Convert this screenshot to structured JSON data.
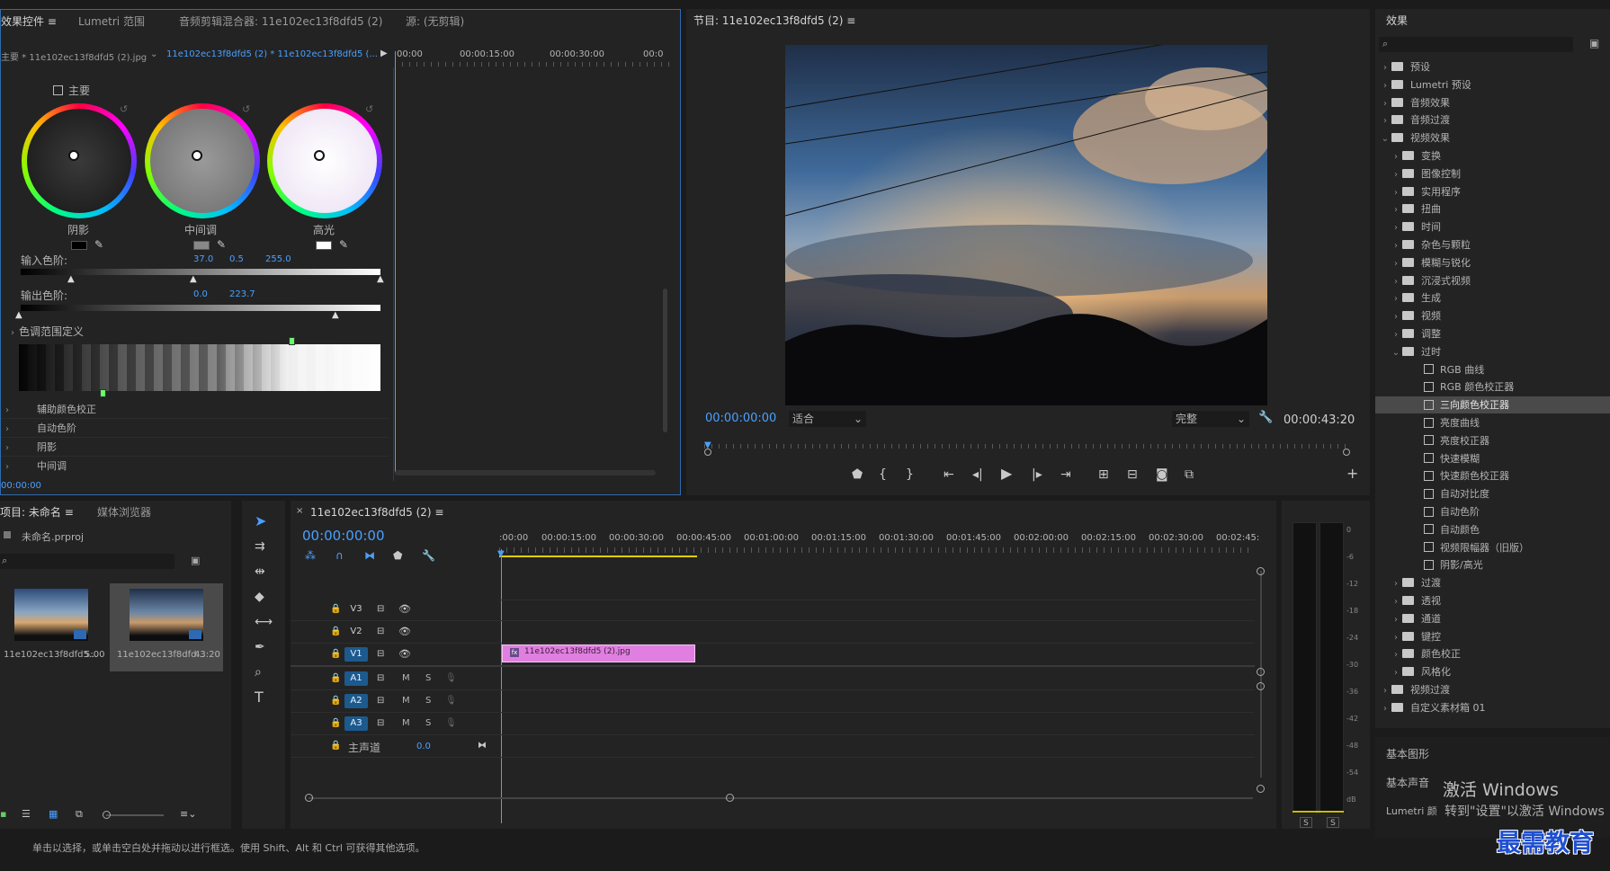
{
  "colors": {
    "accent": "#4aa0ff",
    "clip": "#e07fe0",
    "panel": "#232323"
  },
  "effect_controls": {
    "tabs": [
      "效果控件",
      "Lumetri 范围",
      "音频剪辑混合器: 11e102ec13f8dfd5 (2)",
      "源: (无剪辑)"
    ],
    "master_clip": "主要 * 11e102ec13f8dfd5 (2).jpg",
    "sequence_clip": "11e102ec13f8dfd5 (2) * 11e102ec13f8dfd5 (...",
    "ruler": [
      "00:00",
      "00:00:15:00",
      "00:00:30:00",
      "00:0"
    ],
    "master_label": "主要",
    "wheels": [
      "阴影",
      "中间调",
      "高光"
    ],
    "input_levels_label": "输入色阶:",
    "input_levels": [
      "37.0",
      "0.5",
      "255.0"
    ],
    "output_levels_label": "输出色阶:",
    "output_levels": [
      "0.0",
      "223.7"
    ],
    "tonal_range_label": "色调范围定义",
    "sections": [
      "辅助颜色校正",
      "自动色阶",
      "阴影",
      "中间调"
    ],
    "timecode": "00:00:00"
  },
  "program": {
    "title": "节目: 11e102ec13f8dfd5 (2)",
    "timecode": "00:00:00:00",
    "fit": "适合",
    "quality": "完整",
    "duration": "00:00:43:20"
  },
  "project": {
    "tabs": [
      "项目: 未命名",
      "媒体浏览器"
    ],
    "file": "未命名.prproj",
    "items": [
      {
        "name": "11e102ec13f8dfd5...",
        "duration": "5:00"
      },
      {
        "name": "11e102ec13f8dfd...",
        "duration": "43:20"
      }
    ]
  },
  "timeline": {
    "title": "11e102ec13f8dfd5 (2)",
    "timecode": "00:00:00:00",
    "ruler": [
      ":00:00",
      "00:00:15:00",
      "00:00:30:00",
      "00:00:45:00",
      "00:01:00:00",
      "00:01:15:00",
      "00:01:30:00",
      "00:01:45:00",
      "00:02:00:00",
      "00:02:15:00",
      "00:02:30:00",
      "00:02:45:"
    ],
    "video_tracks": [
      "V3",
      "V2",
      "V1"
    ],
    "audio_tracks": [
      "A1",
      "A2",
      "A3"
    ],
    "master_label": "主声道",
    "master_value": "0.0",
    "m": "M",
    "s": "S",
    "clip_name": "11e102ec13f8dfd5 (2).jpg"
  },
  "meter": {
    "scale": [
      "0",
      "-6",
      "-12",
      "-18",
      "-24",
      "-30",
      "-36",
      "-42",
      "-48",
      "-54",
      "dB"
    ],
    "solo": [
      "S",
      "S"
    ]
  },
  "effects": {
    "title": "效果",
    "tree": [
      {
        "label": "预设",
        "level": 0,
        "type": "bin",
        "open": false
      },
      {
        "label": "Lumetri 预设",
        "level": 0,
        "type": "bin",
        "open": false
      },
      {
        "label": "音频效果",
        "level": 0,
        "type": "folder",
        "open": false
      },
      {
        "label": "音频过渡",
        "level": 0,
        "type": "folder",
        "open": false
      },
      {
        "label": "视频效果",
        "level": 0,
        "type": "folder",
        "open": true
      },
      {
        "label": "变换",
        "level": 1,
        "type": "folder",
        "open": false
      },
      {
        "label": "图像控制",
        "level": 1,
        "type": "folder",
        "open": false
      },
      {
        "label": "实用程序",
        "level": 1,
        "type": "folder",
        "open": false
      },
      {
        "label": "扭曲",
        "level": 1,
        "type": "folder",
        "open": false
      },
      {
        "label": "时间",
        "level": 1,
        "type": "folder",
        "open": false
      },
      {
        "label": "杂色与颗粒",
        "level": 1,
        "type": "folder",
        "open": false
      },
      {
        "label": "模糊与锐化",
        "level": 1,
        "type": "folder",
        "open": false
      },
      {
        "label": "沉浸式视频",
        "level": 1,
        "type": "folder",
        "open": false
      },
      {
        "label": "生成",
        "level": 1,
        "type": "folder",
        "open": false
      },
      {
        "label": "视频",
        "level": 1,
        "type": "folder",
        "open": false
      },
      {
        "label": "调整",
        "level": 1,
        "type": "folder",
        "open": false
      },
      {
        "label": "过时",
        "level": 1,
        "type": "folder",
        "open": true
      },
      {
        "label": "RGB 曲线",
        "level": 2,
        "type": "fx"
      },
      {
        "label": "RGB 颜色校正器",
        "level": 2,
        "type": "fx"
      },
      {
        "label": "三向颜色校正器",
        "level": 2,
        "type": "fx",
        "selected": true
      },
      {
        "label": "亮度曲线",
        "level": 2,
        "type": "fx"
      },
      {
        "label": "亮度校正器",
        "level": 2,
        "type": "fx"
      },
      {
        "label": "快速模糊",
        "level": 2,
        "type": "fx"
      },
      {
        "label": "快速颜色校正器",
        "level": 2,
        "type": "fx"
      },
      {
        "label": "自动对比度",
        "level": 2,
        "type": "fx"
      },
      {
        "label": "自动色阶",
        "level": 2,
        "type": "fx"
      },
      {
        "label": "自动颜色",
        "level": 2,
        "type": "fx"
      },
      {
        "label": "视频限幅器（旧版）",
        "level": 2,
        "type": "fx"
      },
      {
        "label": "阴影/高光",
        "level": 2,
        "type": "fx"
      },
      {
        "label": "过渡",
        "level": 1,
        "type": "folder",
        "open": false
      },
      {
        "label": "透视",
        "level": 1,
        "type": "folder",
        "open": false
      },
      {
        "label": "通道",
        "level": 1,
        "type": "folder",
        "open": false
      },
      {
        "label": "键控",
        "level": 1,
        "type": "folder",
        "open": false
      },
      {
        "label": "颜色校正",
        "level": 1,
        "type": "folder",
        "open": false
      },
      {
        "label": "风格化",
        "level": 1,
        "type": "folder",
        "open": false
      },
      {
        "label": "视频过渡",
        "level": 0,
        "type": "folder",
        "open": false
      },
      {
        "label": "自定义素材箱 01",
        "level": 0,
        "type": "bin",
        "open": false
      }
    ],
    "bottom_panels": [
      "基本图形",
      "基本声音",
      "Lumetri 颜"
    ]
  },
  "watermark": {
    "line1": "激活 Windows",
    "line2": "转到\"设置\"以激活 Windows",
    "brand": "最需教育"
  },
  "status": "单击以选择，或单击空白处并拖动以进行框选。使用 Shift、Alt 和 Ctrl 可获得其他选项。"
}
